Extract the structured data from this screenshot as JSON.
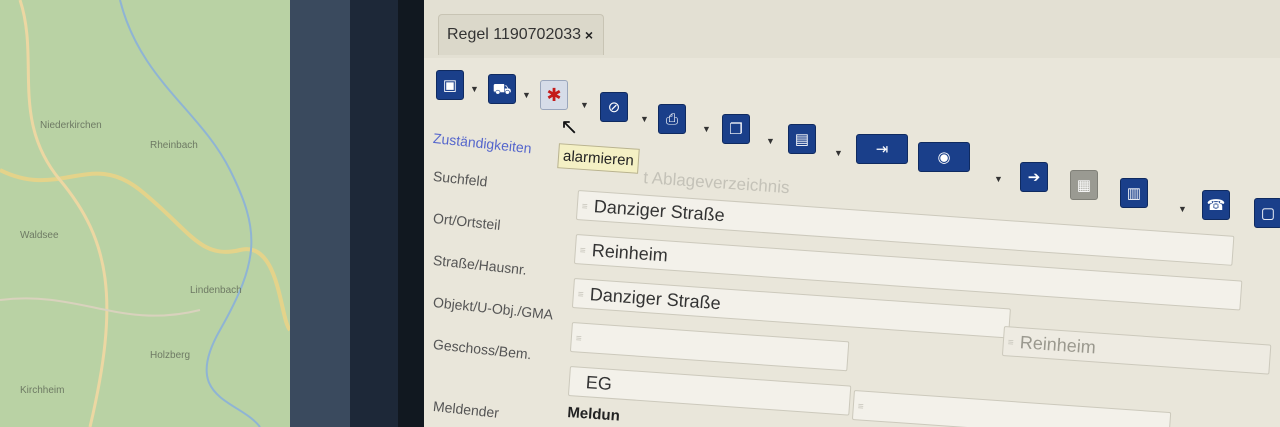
{
  "map": {
    "labels": [
      "Niederkirchen",
      "Rheinbach",
      "Waldsee",
      "Lindenbach",
      "Holzberg",
      "Kirchheim"
    ]
  },
  "window": {
    "tab": {
      "label": "Regel 1190702033",
      "close_glyph": "×"
    }
  },
  "toolbar": {
    "tooltip": "alarmieren",
    "buttons": [
      {
        "name": "save-button",
        "icon": "save-icon",
        "glyph": "▣"
      },
      {
        "name": "vehicle-button",
        "icon": "truck-icon",
        "glyph": "⛟"
      },
      {
        "name": "alarm-button",
        "icon": "siren-icon",
        "glyph": "✱"
      },
      {
        "name": "navigation-button",
        "icon": "compass-icon",
        "glyph": "⊘"
      },
      {
        "name": "print-button",
        "icon": "printer-icon",
        "glyph": "⎙"
      },
      {
        "name": "copy-button",
        "icon": "documents-icon",
        "glyph": "❐"
      },
      {
        "name": "document-button",
        "icon": "document-icon",
        "glyph": "▤"
      },
      {
        "name": "transfer-button",
        "icon": "monitor-transfer-icon",
        "glyph": "⇥"
      },
      {
        "name": "radio-button",
        "icon": "radio-icon",
        "glyph": "◉"
      },
      {
        "name": "forward-button",
        "icon": "forward-icon",
        "glyph": "➔"
      },
      {
        "name": "grid-button",
        "icon": "grid-icon",
        "glyph": "▦"
      },
      {
        "name": "chart-button",
        "icon": "chart-icon",
        "glyph": "▥"
      },
      {
        "name": "phone-button",
        "icon": "phone-icon",
        "glyph": "☎"
      },
      {
        "name": "extra-button",
        "icon": "window-icon",
        "glyph": "▢"
      }
    ],
    "dropdown_glyph": "▼"
  },
  "form": {
    "section_title": "Zuständigkeiten",
    "labels": {
      "suchfeld": "Suchfeld",
      "ort": "Ort/Ortsteil",
      "strasse": "Straße/Hausnr.",
      "objekt": "Objekt/U-Obj./GMA",
      "geschoss": "Geschoss/Bem.",
      "melder": "Meldender"
    },
    "ghost_text": "Ablageverzeichnis",
    "ghost_prefix": "t",
    "fields": {
      "suchfeld": "Danziger Straße",
      "ort": "Reinheim",
      "strasse": "Danziger Straße",
      "objekt": "",
      "ort_right": "Reinheim",
      "geschoss": "EG",
      "geschoss_right": ""
    },
    "truncated_heading": "Meldun"
  },
  "colors": {
    "accent_link": "#5566cc",
    "toolbar_icon": "#1a3f8a",
    "alarm": "#c41a1a",
    "tooltip_bg": "#f4f0c4"
  }
}
